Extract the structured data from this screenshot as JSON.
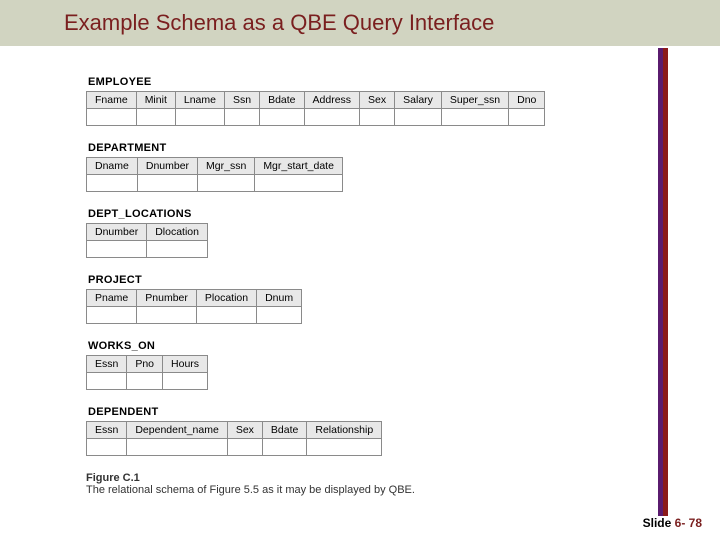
{
  "title": "Example Schema as a QBE Query Interface",
  "tables": [
    {
      "name": "EMPLOYEE",
      "cols": [
        "Fname",
        "Minit",
        "Lname",
        "Ssn",
        "Bdate",
        "Address",
        "Sex",
        "Salary",
        "Super_ssn",
        "Dno"
      ]
    },
    {
      "name": "DEPARTMENT",
      "cols": [
        "Dname",
        "Dnumber",
        "Mgr_ssn",
        "Mgr_start_date"
      ]
    },
    {
      "name": "DEPT_LOCATIONS",
      "cols": [
        "Dnumber",
        "Dlocation"
      ]
    },
    {
      "name": "PROJECT",
      "cols": [
        "Pname",
        "Pnumber",
        "Plocation",
        "Dnum"
      ]
    },
    {
      "name": "WORKS_ON",
      "cols": [
        "Essn",
        "Pno",
        "Hours"
      ]
    },
    {
      "name": "DEPENDENT",
      "cols": [
        "Essn",
        "Dependent_name",
        "Sex",
        "Bdate",
        "Relationship"
      ]
    }
  ],
  "figure": {
    "label": "Figure C.1",
    "caption": "The relational schema of Figure 5.5 as it may be displayed by QBE."
  },
  "footer": {
    "slide_word": "Slide ",
    "page": "6- 78"
  }
}
